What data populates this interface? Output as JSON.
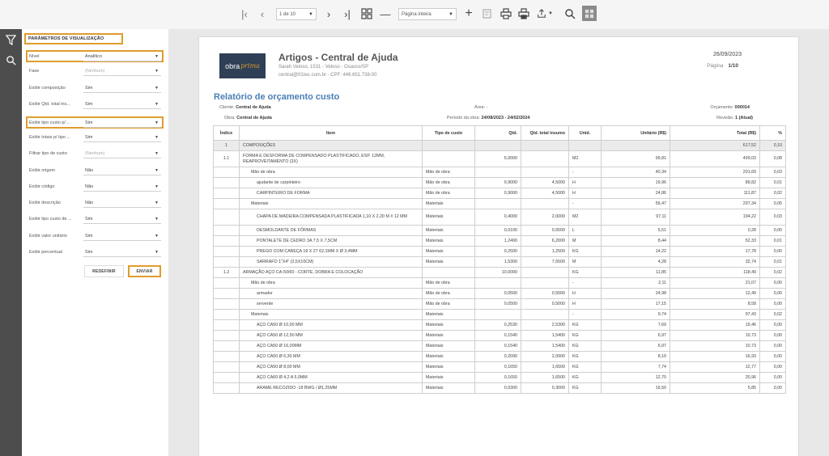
{
  "toolbar": {
    "page_select": "1 de 10",
    "zoom_select": "Página inteira"
  },
  "panel": {
    "title": "PARÂMETROS DE VISUALIZAÇÃO",
    "params": [
      {
        "label": "Nível",
        "value": "Analítico",
        "muted": false
      },
      {
        "label": "Fase",
        "value": "(Nenhum)",
        "muted": true
      },
      {
        "label": "Exibir composição",
        "value": "Sim",
        "muted": false
      },
      {
        "label": "Exibir Qtd. total ins...",
        "value": "Sim",
        "muted": false
      },
      {
        "label": "Exibir tipo custo p/ ...",
        "value": "Sim",
        "muted": false
      },
      {
        "label": "Exibir totais p/ tipo ...",
        "value": "Sim",
        "muted": false
      },
      {
        "label": "Filtrar tipo de custo",
        "value": "(Nenhum)",
        "muted": true
      },
      {
        "label": "Exibir origem",
        "value": "Não",
        "muted": false
      },
      {
        "label": "Exibir código",
        "value": "Não",
        "muted": false
      },
      {
        "label": "Exibir descrição",
        "value": "Não",
        "muted": false
      },
      {
        "label": "Exibir tipo custo de ...",
        "value": "Sim",
        "muted": false
      },
      {
        "label": "Exibir valor unitário",
        "value": "Sim",
        "muted": false
      },
      {
        "label": "Exibir percentual",
        "value": "Sim",
        "muted": false
      }
    ],
    "reset_label": "REDEFINIR",
    "send_label": "ENVIAR"
  },
  "report": {
    "logo_part1": "obra",
    "logo_part2": "prima",
    "company": "Artigos - Central de Ajuda",
    "address": "Sarah Veloso, 1531 - Veloso - Osasco/SP",
    "contact": "central@01tec.com.br - CPF: 446.651.738-00",
    "date": "26/09/2023",
    "page_label": "Página",
    "page_value": "1/10",
    "title": "Relatório de orçamento custo",
    "client_label": "Cliente:",
    "client_value": "Central de Ajuda",
    "area_label": "Área:",
    "area_value": "-",
    "budget_label": "Orçamento:",
    "budget_value": "000014",
    "work_label": "Obra:",
    "work_value": "Central de Ajuda",
    "period_label": "Período da obra:",
    "period_value": "24/08/2023 - 24/02/2024",
    "revision_label": "Revisão:",
    "revision_value": "1 (Atual)",
    "columns": [
      "Índice",
      "Item",
      "Tipo de custo",
      "Qtd.",
      "Qtd. total insumo",
      "Unid.",
      "Unitário (R$)",
      "Total (R$)",
      "%"
    ],
    "rows": [
      {
        "level": "grp",
        "idx": "1",
        "item": "COMPOSIÇÕES",
        "tipo": "",
        "qtd": "",
        "qtdt": "",
        "unid": "",
        "unit": "",
        "total": "617,52",
        "pct": "0,10"
      },
      {
        "level": "comp",
        "tall": true,
        "idx": "1.1",
        "item": "FORMA E DESFORMA DE COMPENSADO PLASTIFICADO, ESP. 12MM, REAPROVEITAMENTO (3X)",
        "tipo": "",
        "qtd": "5,0000",
        "qtdt": "",
        "unid": "M2",
        "unit": "99,81",
        "total": "499,03",
        "pct": "0,08"
      },
      {
        "level": "cat",
        "idx": "",
        "item": "Mão de obra",
        "tipo": "Mão de obra",
        "qtd": "",
        "qtdt": "",
        "unid": "-",
        "unit": "40,34",
        "total": "201,69",
        "pct": "0,03"
      },
      {
        "level": "ins",
        "idx": "",
        "item": "ajudante de carpinteiro",
        "tipo": "Mão de obra",
        "qtd": "0,9000",
        "qtdt": "4,5000",
        "unid": "H",
        "unit": "19,96",
        "total": "89,82",
        "pct": "0,01"
      },
      {
        "level": "ins",
        "idx": "",
        "item": "CARPINTEIRO DE FORMA",
        "tipo": "Mão de obra",
        "qtd": "0,9000",
        "qtdt": "4,5000",
        "unid": "H",
        "unit": "24,86",
        "total": "111,87",
        "pct": "0,02"
      },
      {
        "level": "cat",
        "idx": "",
        "item": "Materiais",
        "tipo": "Materiais",
        "qtd": "",
        "qtdt": "",
        "unid": "-",
        "unit": "59,47",
        "total": "297,34",
        "pct": "0,05"
      },
      {
        "level": "ins",
        "tall": true,
        "idx": "",
        "item": "CHAPA DE MADEIRA COMPENSADA PLASTIFICADA 1,10 X 2,20 M # 12 MM",
        "tipo": "Materiais",
        "qtd": "0,4000",
        "qtdt": "2,0000",
        "unid": "M2",
        "unit": "97,11",
        "total": "194,22",
        "pct": "0,03"
      },
      {
        "level": "ins",
        "idx": "",
        "item": "DESMOLDANTE DE FÔRMAS",
        "tipo": "Materiais",
        "qtd": "0,0100",
        "qtdt": "0,0500",
        "unid": "L",
        "unit": "5,51",
        "total": "0,28",
        "pct": "0,00"
      },
      {
        "level": "ins",
        "idx": "",
        "item": "PONTALETE DE CEDRO 3A 7,5 X 7,5CM",
        "tipo": "Materiais",
        "qtd": "1,2400",
        "qtdt": "6,2000",
        "unid": "M",
        "unit": "8,44",
        "total": "52,33",
        "pct": "0,01"
      },
      {
        "level": "ins",
        "idx": "",
        "item": "PREGO COM CABEÇA 18 X 27 62,1MM X Ø 3,4MM",
        "tipo": "Materiais",
        "qtd": "0,2500",
        "qtdt": "1,2500",
        "unid": "KG",
        "unit": "14,22",
        "total": "17,78",
        "pct": "0,00"
      },
      {
        "level": "ins",
        "idx": "",
        "item": "SARRAFO 1\"X4\" (2,5X10CM)",
        "tipo": "Materiais",
        "qtd": "1,5300",
        "qtdt": "7,6500",
        "unid": "M",
        "unit": "4,28",
        "total": "32,74",
        "pct": "0,01"
      },
      {
        "level": "comp",
        "idx": "1.2",
        "item": "ARMAÇÃO AÇO CA-50/60 - CORTE, DOBRA E COLOCAÇÃO",
        "tipo": "",
        "qtd": "10,0000",
        "qtdt": "",
        "unid": "KG",
        "unit": "11,85",
        "total": "118,49",
        "pct": "0,02"
      },
      {
        "level": "cat",
        "idx": "",
        "item": "Mão de obra",
        "tipo": "Mão de obra",
        "qtd": "",
        "qtdt": "",
        "unid": "-",
        "unit": "2,11",
        "total": "21,07",
        "pct": "0,00"
      },
      {
        "level": "ins",
        "idx": "",
        "item": "armador",
        "tipo": "Mão de obra",
        "qtd": "0,0500",
        "qtdt": "0,5000",
        "unid": "H",
        "unit": "24,98",
        "total": "12,49",
        "pct": "0,00"
      },
      {
        "level": "ins",
        "idx": "",
        "item": "servente",
        "tipo": "Mão de obra",
        "qtd": "0,0500",
        "qtdt": "0,5000",
        "unid": "H",
        "unit": "17,15",
        "total": "8,58",
        "pct": "0,00"
      },
      {
        "level": "cat",
        "idx": "",
        "item": "Materiais",
        "tipo": "Materiais",
        "qtd": "",
        "qtdt": "",
        "unid": "-",
        "unit": "9,74",
        "total": "97,43",
        "pct": "0,02"
      },
      {
        "level": "ins",
        "idx": "",
        "item": "AÇO CA50 Ø 10,00 MM",
        "tipo": "Materiais",
        "qtd": "0,2530",
        "qtdt": "2,5300",
        "unid": "KG",
        "unit": "7,69",
        "total": "19,46",
        "pct": "0,00"
      },
      {
        "level": "ins",
        "idx": "",
        "item": "AÇO CA50 Ø 12,50 MM",
        "tipo": "Materiais",
        "qtd": "0,1540",
        "qtdt": "1,5400",
        "unid": "KG",
        "unit": "6,97",
        "total": "10,73",
        "pct": "0,00"
      },
      {
        "level": "ins",
        "idx": "",
        "item": "AÇO CA50 Ø 16,00MM",
        "tipo": "Materiais",
        "qtd": "0,1540",
        "qtdt": "1,5400",
        "unid": "KG",
        "unit": "6,97",
        "total": "10,73",
        "pct": "0,00"
      },
      {
        "level": "ins",
        "idx": "",
        "item": "AÇO CA50 Ø 6,30 MM",
        "tipo": "Materiais",
        "qtd": "0,2090",
        "qtdt": "2,0900",
        "unid": "KG",
        "unit": "8,10",
        "total": "16,93",
        "pct": "0,00"
      },
      {
        "level": "ins",
        "idx": "",
        "item": "AÇO CA50 Ø 8,00 MM",
        "tipo": "Materiais",
        "qtd": "0,1650",
        "qtdt": "1,6500",
        "unid": "KG",
        "unit": "7,74",
        "total": "12,77",
        "pct": "0,00"
      },
      {
        "level": "ins",
        "idx": "",
        "item": "AÇO CA60 Ø 4,2 A 5,0MM",
        "tipo": "Materiais",
        "qtd": "0,1650",
        "qtdt": "1,6500",
        "unid": "KG",
        "unit": "12,70",
        "total": "20,96",
        "pct": "0,00"
      },
      {
        "level": "ins",
        "idx": "",
        "item": "ARAME RECOZIDO -18 BWG / Ø1,25MM",
        "tipo": "Materiais",
        "qtd": "0,0300",
        "qtdt": "0,3000",
        "unid": "KG",
        "unit": "19,50",
        "total": "5,85",
        "pct": "0,00"
      }
    ]
  }
}
